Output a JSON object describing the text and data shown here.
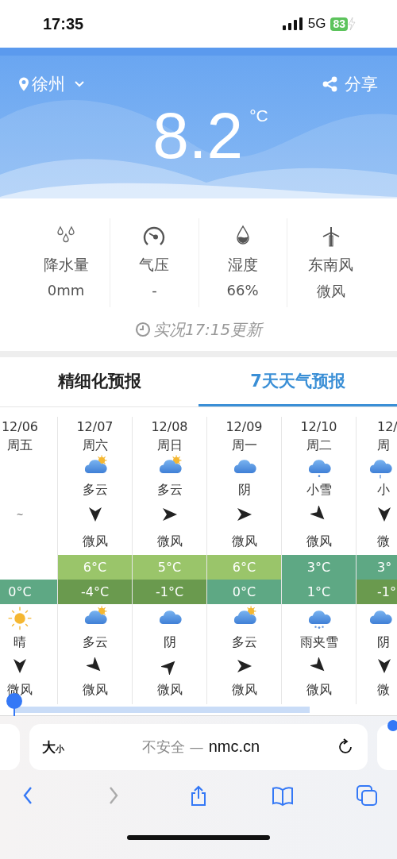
{
  "status_bar": {
    "time": "17:35",
    "network": "5G",
    "battery": "83"
  },
  "header": {
    "location": "徐州",
    "share": "分享",
    "temperature": "8.2",
    "unit": "°C"
  },
  "stats": [
    {
      "kind": "precipitation",
      "label": "降水量",
      "value": "0mm"
    },
    {
      "kind": "pressure",
      "label": "气压",
      "value": "-"
    },
    {
      "kind": "humidity",
      "label": "湿度",
      "value": "66%"
    },
    {
      "kind": "wind",
      "label": "东南风",
      "value": "微风"
    }
  ],
  "update_time": "实况17:15更新",
  "tabs": [
    {
      "label": "精细化预报",
      "selected": false
    },
    {
      "label": "7天天气预报",
      "selected": true
    }
  ],
  "forecast": [
    {
      "date": "12/06",
      "weekday": "周五",
      "day": {
        "note": "~"
      },
      "low": {
        "text": "0°C",
        "color": "#5ea884"
      },
      "night": {
        "sky": {
          "kind": "sunny"
        },
        "weather": "晴",
        "arrow": {
          "kind": "down"
        },
        "wind": "微风"
      }
    },
    {
      "date": "12/07",
      "weekday": "周六",
      "day": {
        "sky": {
          "kind": "partly-cloudy"
        },
        "weather": "多云",
        "arrow": {
          "kind": "down"
        },
        "wind": "微风"
      },
      "high": {
        "text": "6°C",
        "color": "#9ac56a"
      },
      "low": {
        "text": "-4°C",
        "color": "#6a9a4e"
      },
      "night": {
        "sky": {
          "kind": "partly-cloudy"
        },
        "weather": "多云",
        "arrow": {
          "kind": "down-right"
        },
        "wind": "微风"
      }
    },
    {
      "date": "12/08",
      "weekday": "周日",
      "day": {
        "sky": {
          "kind": "partly-cloudy"
        },
        "weather": "多云",
        "arrow": {
          "kind": "right"
        },
        "wind": "微风"
      },
      "high": {
        "text": "5°C",
        "color": "#9ac56a"
      },
      "low": {
        "text": "-1°C",
        "color": "#6a9a4e"
      },
      "night": {
        "sky": {
          "kind": "cloudy"
        },
        "weather": "阴",
        "arrow": {
          "kind": "up-right"
        },
        "wind": "微风"
      }
    },
    {
      "date": "12/09",
      "weekday": "周一",
      "day": {
        "sky": {
          "kind": "cloudy"
        },
        "weather": "阴",
        "arrow": {
          "kind": "right"
        },
        "wind": "微风"
      },
      "high": {
        "text": "6°C",
        "color": "#9ac56a"
      },
      "low": {
        "text": "0°C",
        "color": "#5ea884"
      },
      "night": {
        "sky": {
          "kind": "partly-cloudy"
        },
        "weather": "多云",
        "arrow": {
          "kind": "right"
        },
        "wind": "微风"
      }
    },
    {
      "date": "12/10",
      "weekday": "周二",
      "day": {
        "sky": {
          "kind": "snow"
        },
        "weather": "小雪",
        "arrow": {
          "kind": "down-right"
        },
        "wind": "微风"
      },
      "high": {
        "text": "3°C",
        "color": "#5ea884"
      },
      "low": {
        "text": "1°C",
        "color": "#5ea884"
      },
      "night": {
        "sky": {
          "kind": "sleet"
        },
        "weather": "雨夹雪",
        "arrow": {
          "kind": "down-right"
        },
        "wind": "微风"
      }
    },
    {
      "date": "12/",
      "weekday": "周",
      "day": {
        "sky": {
          "kind": "rain"
        },
        "weather": "小",
        "arrow": {
          "kind": "down"
        },
        "wind": "微"
      },
      "high": {
        "text": "3°",
        "color": "#5ea884"
      },
      "low": {
        "text": "-1°",
        "color": "#6a9a4e"
      },
      "night": {
        "sky": {
          "kind": "cloudy"
        },
        "weather": "阴",
        "arrow": {
          "kind": "down"
        },
        "wind": "微"
      }
    }
  ],
  "browser": {
    "text_size": "大$_{小}$",
    "security": "不安全 —",
    "domain": "nmc.cn",
    "toolbar": [
      {
        "kind": "back",
        "disabled": false
      },
      {
        "kind": "forward",
        "disabled": true
      },
      {
        "kind": "share",
        "disabled": false
      },
      {
        "kind": "bookmarks",
        "disabled": false
      },
      {
        "kind": "tabs",
        "disabled": false
      }
    ]
  }
}
